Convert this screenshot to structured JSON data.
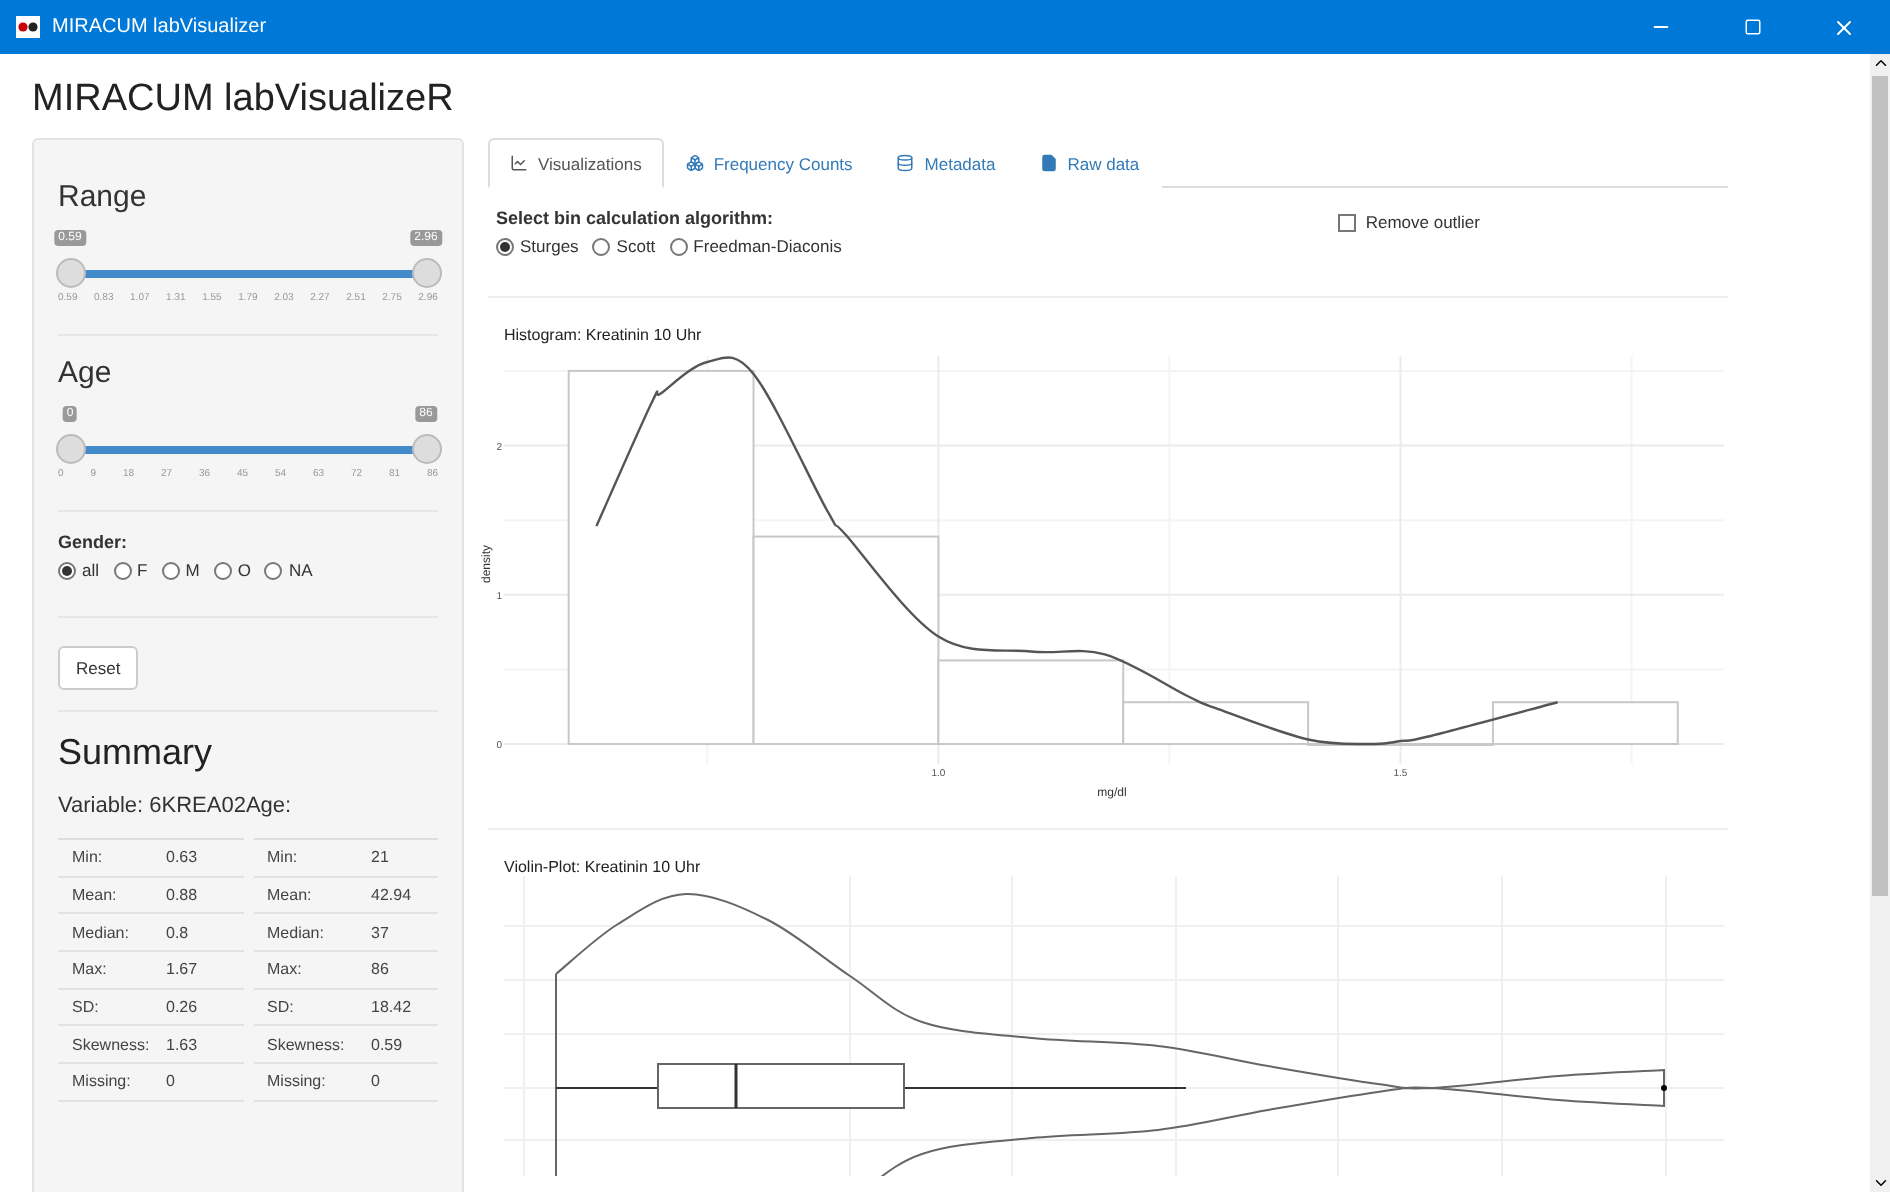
{
  "window": {
    "title": "MIRACUM labVisualizer"
  },
  "app_title": "MIRACUM labVisualizeR",
  "sidebar": {
    "range": {
      "heading": "Range",
      "thumbs": [
        {
          "label": "0.59",
          "level": 0
        },
        {
          "label": "2.96",
          "level": 1
        }
      ],
      "ticks": [
        "0.59",
        "0.83",
        "1.07",
        "1.31",
        "1.55",
        "1.79",
        "2.03",
        "2.27",
        "2.51",
        "2.75",
        "2.96"
      ]
    },
    "age": {
      "heading": "Age",
      "thumbs": [
        {
          "label": "0",
          "level": 0
        },
        {
          "label": "86",
          "level": 1
        }
      ],
      "ticks": [
        "0",
        "9",
        "18",
        "27",
        "36",
        "45",
        "54",
        "63",
        "72",
        "81",
        "86"
      ]
    },
    "gender": {
      "label": "Gender:",
      "options": [
        {
          "label": "all",
          "selected": true
        },
        {
          "label": "F",
          "selected": false
        },
        {
          "label": "M",
          "selected": false
        },
        {
          "label": "O",
          "selected": false
        },
        {
          "label": "NA",
          "selected": false
        }
      ]
    },
    "reset_button": "Reset",
    "summary": {
      "heading": "Summary",
      "variable_label": "Variable: 6KREA02",
      "age_label": "Age:",
      "tables": [
        {
          "rows": [
            [
              "Min:",
              "0.63"
            ],
            [
              "Mean:",
              "0.88"
            ],
            [
              "Median:",
              "0.8"
            ],
            [
              "Max:",
              "1.67"
            ],
            [
              "SD:",
              "0.26"
            ],
            [
              "Skewness:",
              "1.63"
            ],
            [
              "Missing:",
              "0"
            ]
          ]
        },
        {
          "rows": [
            [
              "Min:",
              "21"
            ],
            [
              "Mean:",
              "42.94"
            ],
            [
              "Median:",
              "37"
            ],
            [
              "Max:",
              "86"
            ],
            [
              "SD:",
              "18.42"
            ],
            [
              "Skewness:",
              "0.59"
            ],
            [
              "Missing:",
              "0"
            ]
          ]
        }
      ]
    }
  },
  "tabs": [
    {
      "label": "Visualizations",
      "kind": "chart",
      "selected": true
    },
    {
      "label": "Frequency Counts",
      "kind": "cubes",
      "selected": false
    },
    {
      "label": "Metadata",
      "kind": "database",
      "selected": false
    },
    {
      "label": "Raw data",
      "kind": "file",
      "selected": false
    }
  ],
  "algorithm": {
    "label": "Select bin calculation algorithm:",
    "options": [
      {
        "label": "Sturges",
        "selected": true
      },
      {
        "label": "Scott",
        "selected": false
      },
      {
        "label": "Freedman-Diaconis",
        "selected": false
      }
    ]
  },
  "remove_outlier": {
    "label": "Remove outlier",
    "checked": false
  },
  "histogram": {
    "chart_data": {
      "type": "bar",
      "title": "Histogram: Kreatinin 10 Uhr",
      "xlabel": "mg/dl",
      "ylabel": "density",
      "x": [
        0.63,
        0.69,
        0.7,
        0.75,
        0.8,
        0.88,
        0.9,
        1.0,
        1.1,
        1.18,
        1.27,
        1.3,
        1.4,
        1.47,
        1.5,
        1.53,
        1.67,
        1.7
      ],
      "series": [
        {
          "color": "#c8c8c8",
          "values": [
            null,
            null,
            2.5,
            null,
            null,
            null,
            1.39,
            null,
            0.56,
            null,
            null,
            0.28,
            null,
            null,
            0,
            null,
            null,
            0.28
          ]
        },
        {
          "type": "line",
          "color": "#555555",
          "values": [
            1.46,
            2.29,
            2.35,
            2.56,
            2.48,
            1.56,
            1.4,
            0.72,
            0.62,
            0.6,
            0.32,
            0.24,
            0.03,
            0,
            0.02,
            0.05,
            0.28,
            null
          ]
        }
      ],
      "xticks": [
        {
          "value": 1.0,
          "label": "1.0"
        },
        {
          "value": 1.5,
          "label": "1.5"
        }
      ],
      "yticks": [
        0,
        1,
        2
      ],
      "xlim": [
        0.53,
        1.85
      ],
      "ylim": [
        0,
        2.6
      ],
      "grid": true
    }
  },
  "violin": {
    "title": "Violin-Plot: Kreatinin 10 Uhr"
  }
}
